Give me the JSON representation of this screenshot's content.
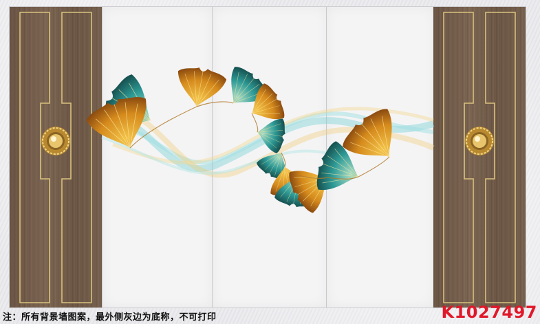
{
  "caption": "注：所有背景墙图案，最外侧灰边为底称，不可打印",
  "product_code": "K1027497",
  "colors": {
    "wood": "#735d4a",
    "gold_trim": "#d9c27e",
    "leaf_teal": "#2a8e8c",
    "leaf_gold": "#d5911f",
    "ribbon_cyan": "#7fd3d6",
    "ribbon_yellow": "#f0c96b",
    "panel": "#f4f4f5",
    "code_red": "#e0192a"
  },
  "icons": [
    "door-knob-icon",
    "ginkgo-leaf-icon",
    "ribbon-swirl-icon"
  ]
}
